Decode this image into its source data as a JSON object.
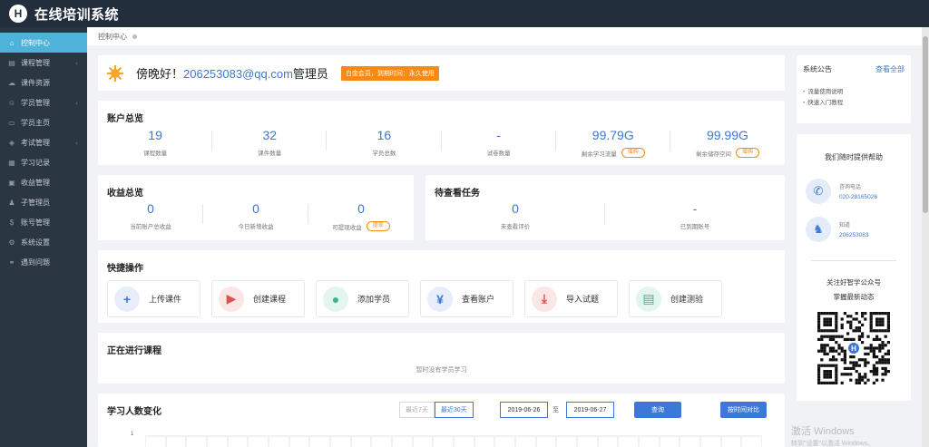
{
  "app": {
    "logo_letter": "H",
    "title": "在线培训系统"
  },
  "sidebar": {
    "items": [
      {
        "label": "控制中心",
        "icon": "home-icon",
        "glyph": "⌂",
        "active": true,
        "chevron": false
      },
      {
        "label": "课程管理",
        "icon": "book-icon",
        "glyph": "▤",
        "active": false,
        "chevron": true
      },
      {
        "label": "课件资源",
        "icon": "cloud-icon",
        "glyph": "☁",
        "active": false,
        "chevron": false
      },
      {
        "label": "学员管理",
        "icon": "users-icon",
        "glyph": "☺",
        "active": false,
        "chevron": true
      },
      {
        "label": "学员主页",
        "icon": "monitor-icon",
        "glyph": "▭",
        "active": false,
        "chevron": false
      },
      {
        "label": "考试管理",
        "icon": "tag-icon",
        "glyph": "◈",
        "active": false,
        "chevron": true
      },
      {
        "label": "学习记录",
        "icon": "record-icon",
        "glyph": "▦",
        "active": false,
        "chevron": false
      },
      {
        "label": "收益管理",
        "icon": "wallet-icon",
        "glyph": "▣",
        "active": false,
        "chevron": false
      },
      {
        "label": "子管理员",
        "icon": "admin-icon",
        "glyph": "♟",
        "active": false,
        "chevron": false
      },
      {
        "label": "账号管理",
        "icon": "dollar-icon",
        "glyph": "$",
        "active": false,
        "chevron": false
      },
      {
        "label": "系统设置",
        "icon": "gear-icon",
        "glyph": "⚙",
        "active": false,
        "chevron": false
      },
      {
        "label": "遇到问题",
        "icon": "link-icon",
        "glyph": "⚭",
        "active": false,
        "chevron": false
      }
    ]
  },
  "breadcrumb": {
    "current": "控制中心"
  },
  "greeting": {
    "text": "傍晚好！",
    "email": "206253083@qq.com",
    "role": "管理员",
    "badge": "白金会员，到期时间：永久使用"
  },
  "account": {
    "title": "账户总览",
    "stats": [
      {
        "value": "19",
        "label": "课程数量",
        "pill": ""
      },
      {
        "value": "32",
        "label": "课件数量",
        "pill": ""
      },
      {
        "value": "16",
        "label": "学员总数",
        "pill": ""
      },
      {
        "value": "-",
        "label": "试卷数量",
        "pill": ""
      },
      {
        "value": "99.79G",
        "label": "剩余学习流量",
        "pill": "增购"
      },
      {
        "value": "99.99G",
        "label": "剩余储存空间",
        "pill": "增购"
      }
    ]
  },
  "income": {
    "title": "收益总览",
    "stats": [
      {
        "value": "0",
        "label": "当前账户总收益",
        "pill": ""
      },
      {
        "value": "0",
        "label": "今日新增收益",
        "pill": ""
      },
      {
        "value": "0",
        "label": "可提现收益",
        "pill": "提现"
      }
    ]
  },
  "pending": {
    "title": "待查看任务",
    "stats": [
      {
        "value": "0",
        "label": "未查看评价",
        "pill": ""
      },
      {
        "value": "-",
        "label": "已到期账号",
        "pill": ""
      }
    ]
  },
  "quick": {
    "title": "快捷操作",
    "actions": [
      {
        "label": "上传课件",
        "icon": "plus-icon",
        "glyph": "+",
        "bg": "#e7eefa",
        "fg": "#3c78d8"
      },
      {
        "label": "创建课程",
        "icon": "video-icon",
        "glyph": "▶",
        "bg": "#fbe6e6",
        "fg": "#d9534f"
      },
      {
        "label": "添加学员",
        "icon": "user-icon",
        "glyph": "●",
        "bg": "#e2f5ee",
        "fg": "#3db389"
      },
      {
        "label": "查看账户",
        "icon": "yen-icon",
        "glyph": "¥",
        "bg": "#e7eefa",
        "fg": "#3c78d8"
      },
      {
        "label": "导入试题",
        "icon": "download-icon",
        "glyph": "⤓",
        "bg": "#fbe6e6",
        "fg": "#d9534f"
      },
      {
        "label": "创建测验",
        "icon": "doc-icon",
        "glyph": "▤",
        "bg": "#e2f5ee",
        "fg": "#3db389"
      }
    ]
  },
  "ongoing": {
    "title": "正在进行课程",
    "empty": "暂时没有学员学习"
  },
  "learners": {
    "title": "学习人数变化",
    "range": [
      "最近7天",
      "最近30天"
    ],
    "start_date": "2019-06-26",
    "to": "至",
    "end_date": "2019-06-27",
    "query": "查询",
    "compare": "按时间对比",
    "y_tick": "1"
  },
  "notice": {
    "title": "系统公告",
    "view_all": "查看全部",
    "items": [
      "流量使用说明",
      "快速入门教程"
    ]
  },
  "help": {
    "title": "我们随时提供帮助",
    "phone_label": "咨询电话",
    "phone": "020-28165026",
    "qq_label": "知道",
    "qq": "206253083",
    "follow_line1": "关注好智学公众号",
    "follow_line2": "掌握最新动态"
  },
  "watermark": {
    "line1": "激活 Windows",
    "line2": "转到\"设置\"以激活 Windows。"
  }
}
